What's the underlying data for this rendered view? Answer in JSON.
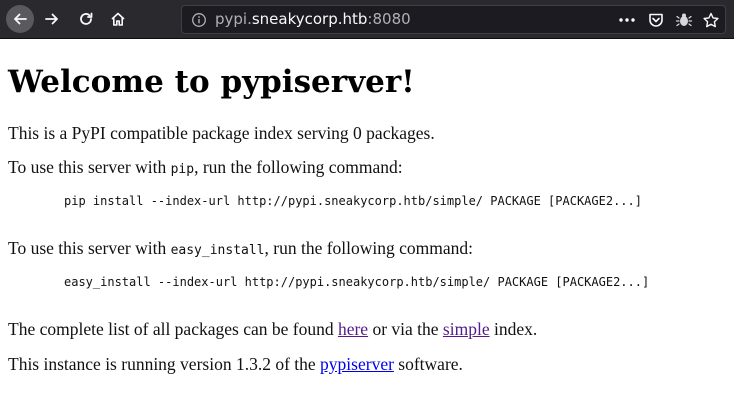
{
  "browser": {
    "url": {
      "host_prefix": "pypi.",
      "domain": "sneakycorp.htb",
      "port": ":8080"
    },
    "icons": {
      "back": "arrow-left-icon",
      "forward": "arrow-right-icon",
      "reload": "reload-icon",
      "home": "home-icon",
      "info": "info-icon",
      "more": "ellipsis-icon",
      "pocket": "pocket-icon",
      "extension": "bug-icon",
      "bookmark": "star-icon"
    },
    "colors": {
      "toolbar_bg": "#2a2a2e",
      "urlbar_bg": "#1c1b22"
    }
  },
  "page": {
    "title": "Welcome to pypiserver!",
    "intro": "This is a PyPI compatible package index serving 0 packages.",
    "pip_section": {
      "before": "To use this server with ",
      "code": "pip",
      "after": ", run the following command:",
      "command": "pip install --index-url http://pypi.sneakycorp.htb/simple/ PACKAGE [PACKAGE2...]"
    },
    "easy_install_section": {
      "before": "To use this server with ",
      "code": "easy_install",
      "after": ", run the following command:",
      "command": "easy_install --index-url http://pypi.sneakycorp.htb/simple/ PACKAGE [PACKAGE2...]"
    },
    "packages_line": {
      "before": "The complete list of all packages can be found ",
      "link_here": "here",
      "middle": " or via the ",
      "link_simple": "simple",
      "after": " index."
    },
    "version_line": {
      "before": "This instance is running version 1.3.2 of the ",
      "link": "pypiserver",
      "after": " software."
    },
    "colors": {
      "visited_link": "#551a8b",
      "link": "#0000ee"
    }
  }
}
